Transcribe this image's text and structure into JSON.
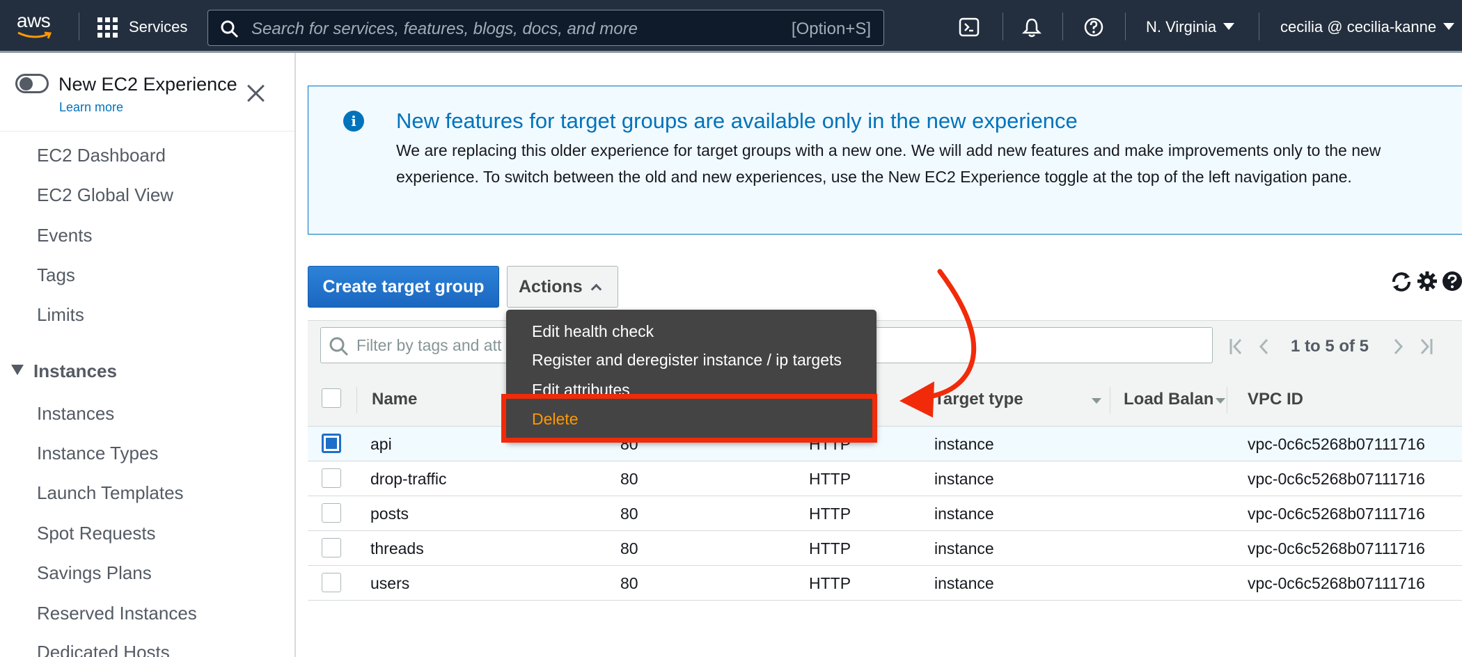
{
  "topnav": {
    "logo_text": "aws",
    "services_label": "Services",
    "search_placeholder": "Search for services, features, blogs, docs, and more",
    "search_shortcut": "[Option+S]",
    "region": "N. Virginia",
    "account": "cecilia @ cecilia-kanne"
  },
  "sidebar": {
    "new_experience_label": "New EC2 Experience",
    "learn_more": "Learn more",
    "items": [
      "EC2 Dashboard",
      "EC2 Global View",
      "Events",
      "Tags",
      "Limits"
    ],
    "instances_section": {
      "title": "Instances",
      "items": [
        "Instances",
        "Instance Types",
        "Launch Templates",
        "Spot Requests",
        "Savings Plans",
        "Reserved Instances",
        "Dedicated Hosts"
      ]
    }
  },
  "alert": {
    "title": "New features for target groups are available only in the new experience",
    "body": "We are replacing this older experience for target groups with a new one. We will add new features and make improvements only to the new experience. To switch between the old and new experiences, use the New EC2 Experience toggle at the top of the left navigation pane."
  },
  "toolbar": {
    "create_label": "Create target group",
    "actions_label": "Actions"
  },
  "actions_menu": {
    "items": [
      "Edit health check",
      "Register and deregister instance / ip targets",
      "Edit attributes",
      "Delete"
    ]
  },
  "filter": {
    "placeholder": "Filter by tags and att"
  },
  "pagination": {
    "text": "1 to 5 of 5"
  },
  "table": {
    "columns": [
      "Name",
      "Target type",
      "Load Balanc",
      "VPC ID"
    ],
    "rows": [
      {
        "name": "api",
        "port": "80",
        "protocol": "HTTP",
        "target_type": "instance",
        "vpc_id": "vpc-0c6c5268b07111716",
        "selected": true
      },
      {
        "name": "drop-traffic",
        "port": "80",
        "protocol": "HTTP",
        "target_type": "instance",
        "vpc_id": "vpc-0c6c5268b07111716",
        "selected": false
      },
      {
        "name": "posts",
        "port": "80",
        "protocol": "HTTP",
        "target_type": "instance",
        "vpc_id": "vpc-0c6c5268b07111716",
        "selected": false
      },
      {
        "name": "threads",
        "port": "80",
        "protocol": "HTTP",
        "target_type": "instance",
        "vpc_id": "vpc-0c6c5268b07111716",
        "selected": false
      },
      {
        "name": "users",
        "port": "80",
        "protocol": "HTTP",
        "target_type": "instance",
        "vpc_id": "vpc-0c6c5268b07111716",
        "selected": false
      }
    ]
  },
  "colors": {
    "nav_bg": "#232f3e",
    "primary": "#1e6fc9",
    "link": "#0073bb",
    "menu_bg": "#444444",
    "menu_highlight": "#ff9900",
    "annotation": "#f12b0a"
  },
  "icons": [
    "aws-smile-icon",
    "services-grid-icon",
    "search-icon",
    "cloudshell-icon",
    "bell-icon",
    "help-icon",
    "caret-down-icon",
    "close-icon",
    "info-icon",
    "refresh-icon",
    "gear-icon",
    "first-page-icon",
    "prev-page-icon",
    "next-page-icon",
    "last-page-icon",
    "arrow-annotation-icon"
  ]
}
